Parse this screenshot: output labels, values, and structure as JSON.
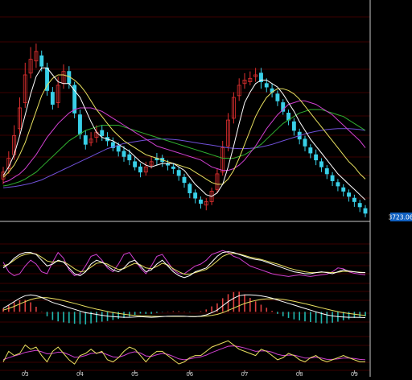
{
  "chart_data": {
    "type": "candlestick",
    "background": "#000000",
    "colors": {
      "grid": "#7a0000",
      "divider": "#c8c8c8",
      "up_candle": "#e03030",
      "down_candle": "#39d0e8",
      "ma_short": "#ffffff",
      "ma_mid": "#e8e060",
      "ma_long": "#d040d0",
      "ma_longer": "#30b030",
      "ma_longest": "#7050d8",
      "hist_up": "#e04040",
      "hist_down": "#20b8b0",
      "axis_text": "#d0d0d0",
      "price_tag_bg": "#1060c0",
      "price_tag_text": "#ffffff"
    },
    "x_axis": {
      "tick_labels": [
        "03",
        "04",
        "05",
        "06",
        "07",
        "08",
        "09"
      ],
      "tick_positions": [
        4,
        14,
        24,
        34,
        44,
        54,
        64
      ]
    },
    "last_price_label": "3723.06",
    "price": {
      "close": [
        3960,
        4040,
        4170,
        4330,
        4520,
        4610,
        4655,
        4570,
        4430,
        4350,
        4460,
        4540,
        4470,
        4300,
        4180,
        4120,
        4150,
        4190,
        4170,
        4140,
        4100,
        4080,
        4050,
        4030,
        3990,
        3960,
        3990,
        4020,
        4030,
        4020,
        4000,
        3980,
        3940,
        3900,
        3840,
        3810,
        3780,
        3790,
        3850,
        3950,
        4100,
        4260,
        4390,
        4460,
        4490,
        4500,
        4520,
        4480,
        4450,
        4420,
        4370,
        4310,
        4260,
        4200,
        4150,
        4110,
        4070,
        4030,
        3990,
        3950,
        3910,
        3880,
        3850,
        3820,
        3790,
        3760,
        3723
      ],
      "open": [
        3920,
        3980,
        4060,
        4210,
        4360,
        4530,
        4600,
        4630,
        4560,
        4420,
        4360,
        4470,
        4540,
        4460,
        4290,
        4170,
        4130,
        4160,
        4200,
        4160,
        4130,
        4110,
        4080,
        4060,
        4020,
        3990,
        3960,
        4000,
        4040,
        4040,
        4010,
        3990,
        3970,
        3930,
        3890,
        3840,
        3800,
        3770,
        3790,
        3860,
        3960,
        4110,
        4270,
        4400,
        4470,
        4480,
        4510,
        4530,
        4470,
        4440,
        4410,
        4360,
        4300,
        4250,
        4190,
        4150,
        4100,
        4060,
        4020,
        3980,
        3940,
        3900,
        3870,
        3840,
        3810,
        3780,
        3750
      ],
      "high": [
        3990,
        4080,
        4230,
        4390,
        4590,
        4680,
        4700,
        4660,
        4590,
        4450,
        4510,
        4580,
        4570,
        4480,
        4320,
        4200,
        4190,
        4230,
        4230,
        4190,
        4160,
        4130,
        4110,
        4090,
        4050,
        4010,
        4020,
        4050,
        4070,
        4060,
        4030,
        4010,
        3990,
        3950,
        3900,
        3860,
        3820,
        3810,
        3870,
        3980,
        4140,
        4300,
        4420,
        4500,
        4530,
        4540,
        4560,
        4560,
        4500,
        4470,
        4430,
        4380,
        4320,
        4270,
        4210,
        4170,
        4120,
        4090,
        4040,
        4000,
        3960,
        3920,
        3890,
        3860,
        3830,
        3800,
        3770
      ],
      "low": [
        3890,
        3950,
        4030,
        4180,
        4330,
        4500,
        4560,
        4540,
        4400,
        4320,
        4330,
        4440,
        4440,
        4270,
        4150,
        4090,
        4110,
        4130,
        4140,
        4110,
        4080,
        4050,
        4020,
        4000,
        3970,
        3930,
        3940,
        3980,
        4000,
        3990,
        3970,
        3950,
        3910,
        3870,
        3810,
        3780,
        3750,
        3740,
        3770,
        3840,
        3940,
        4080,
        4240,
        4370,
        4440,
        4460,
        4480,
        4440,
        4420,
        4390,
        4340,
        4290,
        4230,
        4170,
        4120,
        4080,
        4040,
        4000,
        3960,
        3920,
        3880,
        3850,
        3820,
        3790,
        3760,
        3730,
        3700
      ],
      "ma5": [
        3940,
        3990,
        4060,
        4170,
        4290,
        4410,
        4510,
        4560,
        4560,
        4520,
        4480,
        4470,
        4470,
        4430,
        4390,
        4320,
        4250,
        4190,
        4160,
        4150,
        4140,
        4120,
        4100,
        4080,
        4050,
        4020,
        4000,
        3990,
        4000,
        4010,
        4010,
        4010,
        3990,
        3970,
        3930,
        3890,
        3860,
        3830,
        3820,
        3840,
        3890,
        3990,
        4110,
        4240,
        4360,
        4420,
        4470,
        4490,
        4490,
        4470,
        4450,
        4410,
        4360,
        4310,
        4250,
        4200,
        4150,
        4110,
        4070,
        4030,
        3990,
        3950,
        3920,
        3890,
        3860,
        3830,
        3800
      ],
      "ma10": [
        3930,
        3960,
        4000,
        4060,
        4130,
        4220,
        4310,
        4400,
        4460,
        4500,
        4520,
        4520,
        4510,
        4490,
        4460,
        4420,
        4370,
        4320,
        4280,
        4240,
        4200,
        4170,
        4140,
        4120,
        4100,
        4080,
        4060,
        4050,
        4040,
        4030,
        4020,
        4010,
        4000,
        3990,
        3980,
        3960,
        3940,
        3920,
        3900,
        3890,
        3890,
        3920,
        3970,
        4040,
        4120,
        4200,
        4280,
        4340,
        4390,
        4420,
        4440,
        4440,
        4430,
        4410,
        4380,
        4340,
        4300,
        4260,
        4220,
        4180,
        4140,
        4100,
        4060,
        4020,
        3990,
        3950,
        3920
      ],
      "ma20": [
        3900,
        3910,
        3930,
        3950,
        3980,
        4020,
        4060,
        4110,
        4160,
        4200,
        4240,
        4270,
        4300,
        4320,
        4330,
        4330,
        4330,
        4320,
        4310,
        4290,
        4270,
        4250,
        4230,
        4210,
        4190,
        4170,
        4150,
        4130,
        4110,
        4100,
        4090,
        4080,
        4070,
        4060,
        4050,
        4040,
        4030,
        4010,
        3990,
        3980,
        3970,
        3970,
        3980,
        4000,
        4030,
        4070,
        4110,
        4160,
        4210,
        4250,
        4290,
        4320,
        4350,
        4360,
        4370,
        4370,
        4360,
        4350,
        4330,
        4310,
        4290,
        4260,
        4230,
        4200,
        4170,
        4140,
        4100
      ],
      "ma30": [
        3880,
        3885,
        3895,
        3905,
        3920,
        3940,
        3960,
        3990,
        4020,
        4050,
        4080,
        4110,
        4140,
        4160,
        4180,
        4200,
        4210,
        4220,
        4230,
        4230,
        4230,
        4230,
        4220,
        4210,
        4200,
        4190,
        4180,
        4170,
        4160,
        4150,
        4140,
        4130,
        4120,
        4110,
        4100,
        4090,
        4080,
        4070,
        4060,
        4050,
        4040,
        4040,
        4040,
        4050,
        4060,
        4080,
        4100,
        4120,
        4150,
        4180,
        4210,
        4240,
        4260,
        4280,
        4300,
        4310,
        4320,
        4320,
        4320,
        4310,
        4300,
        4290,
        4280,
        4260,
        4240,
        4220,
        4200
      ],
      "ma60": [
        3870,
        3873,
        3877,
        3882,
        3888,
        3895,
        3905,
        3915,
        3930,
        3945,
        3960,
        3975,
        3990,
        4005,
        4020,
        4035,
        4050,
        4065,
        4080,
        4095,
        4105,
        4115,
        4125,
        4130,
        4135,
        4140,
        4145,
        4148,
        4150,
        4150,
        4150,
        4148,
        4145,
        4140,
        4135,
        4130,
        4125,
        4120,
        4115,
        4110,
        4105,
        4100,
        4097,
        4095,
        4095,
        4097,
        4100,
        4105,
        4112,
        4120,
        4130,
        4140,
        4150,
        4160,
        4170,
        4180,
        4188,
        4195,
        4200,
        4205,
        4208,
        4210,
        4210,
        4210,
        4208,
        4205,
        4200
      ]
    },
    "indicator_1": {
      "line_a": [
        40,
        50,
        65,
        75,
        80,
        80,
        75,
        60,
        45,
        50,
        60,
        55,
        40,
        25,
        20,
        30,
        50,
        60,
        55,
        45,
        35,
        30,
        40,
        55,
        60,
        45,
        30,
        35,
        50,
        60,
        45,
        30,
        20,
        15,
        20,
        30,
        35,
        40,
        55,
        70,
        80,
        82,
        80,
        75,
        70,
        65,
        62,
        60,
        55,
        50,
        45,
        40,
        35,
        30,
        28,
        25,
        25,
        28,
        30,
        28,
        25,
        30,
        35,
        32,
        30,
        28,
        28
      ],
      "line_b": [
        45,
        50,
        60,
        70,
        75,
        78,
        76,
        68,
        58,
        55,
        58,
        56,
        48,
        38,
        30,
        32,
        42,
        52,
        54,
        50,
        42,
        36,
        38,
        46,
        52,
        48,
        40,
        38,
        44,
        52,
        48,
        38,
        30,
        24,
        24,
        28,
        32,
        36,
        46,
        58,
        70,
        76,
        78,
        76,
        72,
        68,
        65,
        62,
        58,
        54,
        50,
        45,
        40,
        36,
        33,
        30,
        28,
        28,
        29,
        29,
        28,
        29,
        31,
        31,
        30,
        29,
        28
      ],
      "line_c": [
        55,
        30,
        20,
        25,
        45,
        60,
        50,
        30,
        25,
        55,
        80,
        65,
        35,
        20,
        25,
        45,
        70,
        75,
        60,
        40,
        30,
        50,
        75,
        80,
        60,
        40,
        25,
        45,
        70,
        75,
        55,
        35,
        25,
        25,
        35,
        45,
        50,
        60,
        75,
        80,
        85,
        80,
        70,
        65,
        55,
        45,
        40,
        35,
        30,
        25,
        22,
        20,
        18,
        20,
        22,
        20,
        18,
        20,
        22,
        24,
        30,
        40,
        38,
        30,
        26,
        24,
        22
      ],
      "ylim": [
        0,
        100
      ]
    },
    "indicator_2": {
      "dif": [
        20,
        40,
        60,
        80,
        95,
        100,
        95,
        85,
        70,
        55,
        45,
        35,
        25,
        15,
        5,
        -5,
        -10,
        -15,
        -20,
        -25,
        -28,
        -30,
        -32,
        -32,
        -30,
        -28,
        -30,
        -32,
        -30,
        -28,
        -26,
        -25,
        -25,
        -26,
        -28,
        -28,
        -25,
        -18,
        -5,
        10,
        35,
        60,
        80,
        95,
        100,
        100,
        98,
        94,
        88,
        80,
        70,
        60,
        50,
        40,
        30,
        20,
        10,
        0,
        -10,
        -18,
        -24,
        -28,
        -30,
        -32,
        -32,
        -33,
        -34
      ],
      "dea": [
        10,
        20,
        32,
        46,
        60,
        72,
        80,
        84,
        83,
        79,
        73,
        66,
        58,
        50,
        41,
        32,
        24,
        16,
        9,
        2,
        -4,
        -9,
        -14,
        -18,
        -21,
        -23,
        -24,
        -26,
        -27,
        -27,
        -27,
        -27,
        -27,
        -27,
        -27,
        -28,
        -27,
        -25,
        -21,
        -15,
        -5,
        8,
        22,
        36,
        49,
        59,
        67,
        73,
        76,
        77,
        76,
        73,
        68,
        62,
        55,
        48,
        40,
        32,
        24,
        16,
        8,
        1,
        -5,
        -10,
        -14,
        -18,
        -21
      ],
      "ylim": [
        -60,
        120
      ]
    },
    "indicator_3": {
      "line_a": [
        -20,
        30,
        10,
        20,
        60,
        40,
        50,
        10,
        -20,
        30,
        50,
        20,
        -10,
        -30,
        10,
        20,
        40,
        20,
        30,
        -10,
        -20,
        0,
        30,
        50,
        40,
        10,
        -20,
        10,
        30,
        30,
        10,
        -10,
        -30,
        -20,
        0,
        10,
        10,
        30,
        50,
        60,
        70,
        80,
        60,
        40,
        30,
        20,
        10,
        40,
        30,
        10,
        -10,
        0,
        20,
        10,
        -10,
        -20,
        0,
        10,
        -10,
        -20,
        -10,
        0,
        10,
        0,
        -10,
        -20,
        -20
      ],
      "line_b": [
        -10,
        0,
        8,
        15,
        25,
        30,
        35,
        28,
        18,
        20,
        26,
        24,
        14,
        2,
        4,
        10,
        20,
        22,
        24,
        14,
        4,
        2,
        10,
        22,
        28,
        22,
        8,
        6,
        14,
        20,
        16,
        6,
        -6,
        -10,
        -6,
        0,
        4,
        12,
        24,
        34,
        44,
        54,
        56,
        52,
        46,
        38,
        30,
        32,
        32,
        26,
        16,
        10,
        12,
        12,
        6,
        -2,
        -2,
        2,
        -2,
        -8,
        -8,
        -6,
        -2,
        -2,
        -4,
        -8,
        -10
      ],
      "ylim": [
        -60,
        100
      ]
    }
  }
}
